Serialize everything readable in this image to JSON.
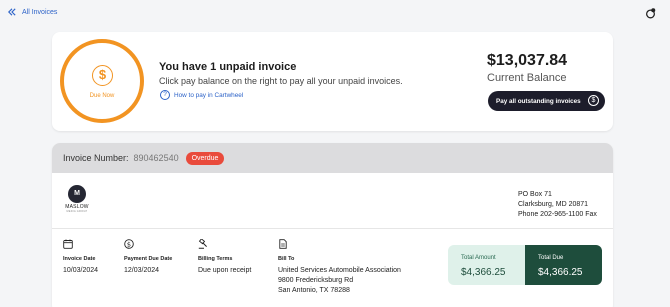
{
  "nav": {
    "back_label": "All Invoices"
  },
  "summary": {
    "due_now_label": "Due Now",
    "title": "You have 1 unpaid invoice",
    "subtitle": "Click pay balance on the right to pay all your unpaid invoices.",
    "help_link": "How to pay in Cartwheel",
    "balance_amount": "$13,037.84",
    "balance_label": "Current Balance",
    "pay_button": "Pay all outstanding invoices"
  },
  "invoice": {
    "number_label": "Invoice Number:",
    "number": "890462540",
    "status": "Overdue",
    "vendor": {
      "logo_letter": "M",
      "logo_name": "MASLOW",
      "logo_sub": "MEDIA GROUP"
    },
    "remit_address": [
      "PO Box 71",
      "Clarksburg, MD 20871",
      "Phone 202-965-1100 Fax"
    ],
    "details": [
      {
        "icon": "calendar-icon",
        "label": "Invoice Date",
        "value": [
          "10/03/2024"
        ]
      },
      {
        "icon": "dollar-icon",
        "label": "Payment Due Date",
        "value": [
          "12/03/2024"
        ]
      },
      {
        "icon": "gavel-icon",
        "label": "Billing Terms",
        "value": [
          "Due upon receipt"
        ]
      },
      {
        "icon": "document-icon",
        "label": "Bill To",
        "value": [
          "United Services Automobile Association",
          "9800 Fredericksburg Rd",
          "San Antonio, TX 78288"
        ]
      }
    ],
    "total_amount_label": "Total Amount",
    "total_amount": "$4,366.25",
    "total_due_label": "Total Due",
    "total_due": "$4,366.25"
  },
  "colors": {
    "accent_orange": "#f29422",
    "link_blue": "#2d63c8",
    "overdue_red": "#e94b3c",
    "dark_green": "#1e4d3c",
    "pay_button_bg": "#1d1d2b"
  }
}
